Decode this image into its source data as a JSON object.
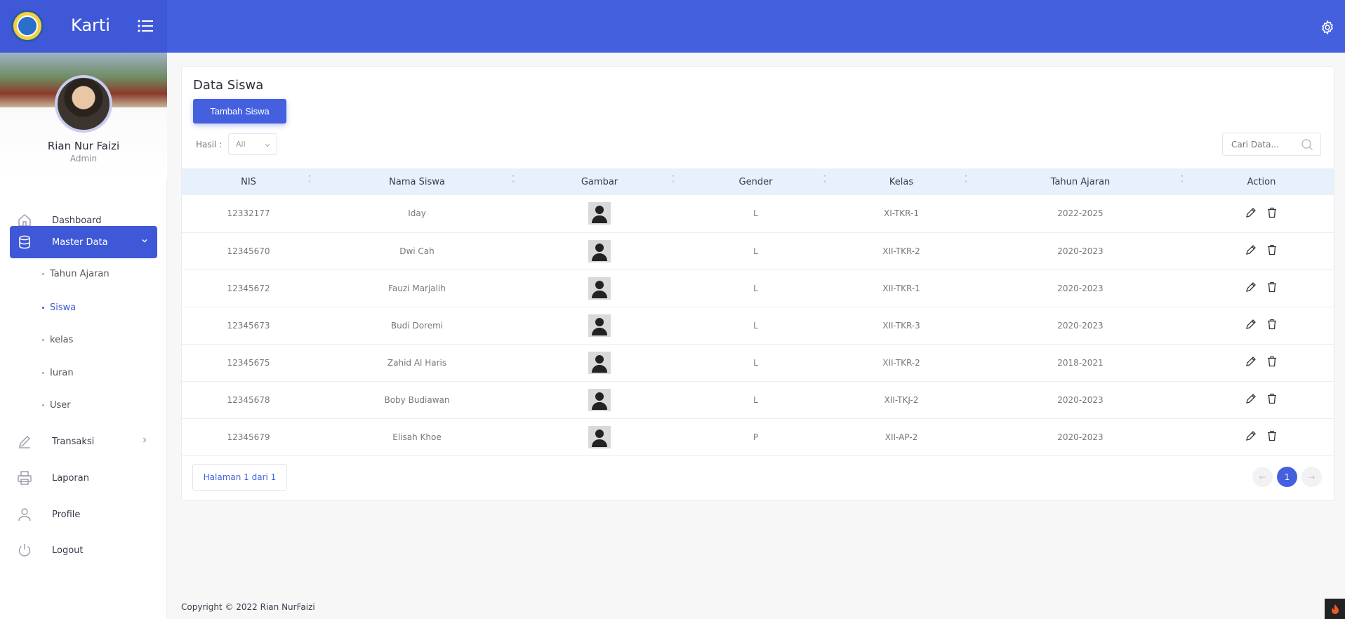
{
  "app": {
    "name": "Karti"
  },
  "user": {
    "name": "Rian Nur Faizi",
    "role": "Admin"
  },
  "sidebar": {
    "items": [
      {
        "label": "Dashboard",
        "icon": "home-icon"
      },
      {
        "label": "Master Data",
        "icon": "database-icon"
      },
      {
        "label": "Transaksi",
        "icon": "pen-icon"
      },
      {
        "label": "Laporan",
        "icon": "printer-icon"
      },
      {
        "label": "Profile",
        "icon": "user-icon"
      },
      {
        "label": "Logout",
        "icon": "power-icon"
      }
    ],
    "submenu": [
      {
        "label": "Tahun Ajaran"
      },
      {
        "label": "Siswa"
      },
      {
        "label": "kelas"
      },
      {
        "label": "Iuran"
      },
      {
        "label": "User"
      }
    ]
  },
  "page": {
    "title": "Data Siswa",
    "add_button": "Tambah Siswa",
    "hasil_label": "Hasil :",
    "hasil_value": "All",
    "search_placeholder": "Cari Data..."
  },
  "table": {
    "headers": [
      "NIS",
      "Nama Siswa",
      "Gambar",
      "Gender",
      "Kelas",
      "Tahun Ajaran",
      "Action"
    ],
    "rows": [
      {
        "nis": "12332177",
        "nama": "Iday",
        "gender": "L",
        "kelas": "XI-TKR-1",
        "tahun": "2022-2025"
      },
      {
        "nis": "12345670",
        "nama": "Dwi Cah",
        "gender": "L",
        "kelas": "XII-TKR-2",
        "tahun": "2020-2023"
      },
      {
        "nis": "12345672",
        "nama": "Fauzi Marjalih",
        "gender": "L",
        "kelas": "XII-TKR-1",
        "tahun": "2020-2023"
      },
      {
        "nis": "12345673",
        "nama": "Budi Doremi",
        "gender": "L",
        "kelas": "XII-TKR-3",
        "tahun": "2020-2023"
      },
      {
        "nis": "12345675",
        "nama": "Zahid Al Haris",
        "gender": "L",
        "kelas": "XII-TKR-2",
        "tahun": "2018-2021"
      },
      {
        "nis": "12345678",
        "nama": "Boby Budiawan",
        "gender": "L",
        "kelas": "XII-TKJ-2",
        "tahun": "2020-2023"
      },
      {
        "nis": "12345679",
        "nama": "Elisah Khoe",
        "gender": "P",
        "kelas": "XII-AP-2",
        "tahun": "2020-2023"
      }
    ]
  },
  "pagination": {
    "info": "Halaman 1 dari 1",
    "current": "1",
    "prev": "←",
    "next": "→"
  },
  "footer": {
    "text": "Copyright © 2022 Rian NurFaizi"
  },
  "colors": {
    "primary": "#4560df",
    "header_row": "#e8f0fc"
  }
}
